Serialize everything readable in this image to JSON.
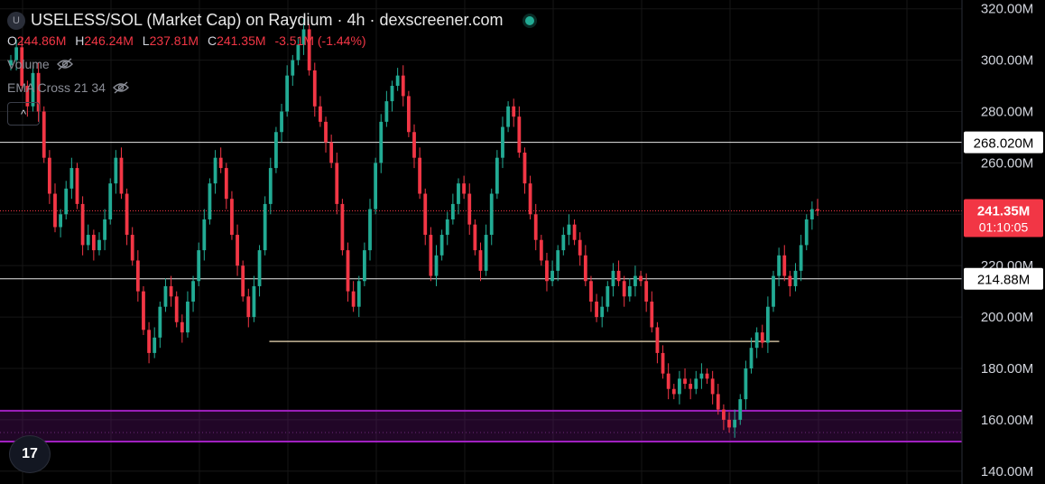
{
  "header": {
    "symbol_initial": "U",
    "title": "USELESS/SOL (Market Cap) on Raydium · 4h · dexscreener.com",
    "ohlc": [
      {
        "key": "O",
        "value": "244.86M"
      },
      {
        "key": "H",
        "value": "246.24M"
      },
      {
        "key": "L",
        "value": "237.81M"
      },
      {
        "key": "C",
        "value": "241.35M"
      }
    ],
    "change": "-3.51M (-1.44%)"
  },
  "indicators": [
    {
      "label": "Volume"
    },
    {
      "label": "EMA Cross 21 34"
    }
  ],
  "collapse_glyph": "^",
  "logo_text": "17",
  "colors": {
    "background": "#000000",
    "up": "#22ab94",
    "down": "#f23645",
    "zone": "#a020c0",
    "white_line": "#e8e8e8",
    "tan_line": "#c8b89a"
  },
  "chart_data": {
    "type": "candlestick",
    "y_unit": "M",
    "ylim": [
      135,
      322
    ],
    "y_ticks": [
      140,
      160,
      180,
      200,
      220,
      240,
      260,
      280,
      300,
      320
    ],
    "y_tick_labels": [
      "140.00M",
      "160.00M",
      "180.00M",
      "200.00M",
      "220.00M",
      "240.00M",
      "260.00M",
      "280.00M",
      "300.00M",
      "320.00M"
    ],
    "horizontal_lines": [
      {
        "value": 268.02,
        "label": "268.020M",
        "style": "solid-white"
      },
      {
        "value": 214.88,
        "label": "214.88M",
        "style": "solid-white"
      },
      {
        "value": 190.5,
        "style": "tan",
        "from": 0.28,
        "to": 0.81
      }
    ],
    "zone": {
      "from": 151.5,
      "to": 163.5
    },
    "last_price": {
      "value": 241.35,
      "label": "241.35M",
      "countdown": "01:10:05"
    },
    "closes": [
      300,
      305,
      290,
      282,
      295,
      280,
      262,
      248,
      235,
      240,
      250,
      258,
      244,
      228,
      232,
      226,
      230,
      238,
      252,
      262,
      248,
      232,
      222,
      210,
      195,
      186,
      192,
      204,
      212,
      208,
      198,
      194,
      206,
      214,
      226,
      238,
      252,
      262,
      258,
      246,
      232,
      220,
      208,
      200,
      212,
      226,
      244,
      258,
      272,
      280,
      294,
      300,
      306,
      312,
      296,
      282,
      276,
      268,
      260,
      244,
      226,
      210,
      204,
      214,
      226,
      242,
      260,
      276,
      284,
      290,
      294,
      286,
      272,
      262,
      248,
      232,
      216,
      224,
      232,
      238,
      244,
      252,
      248,
      236,
      226,
      218,
      232,
      248,
      262,
      274,
      282,
      278,
      264,
      252,
      240,
      230,
      222,
      214,
      218,
      226,
      232,
      236,
      230,
      224,
      214,
      206,
      200,
      204,
      212,
      218,
      214,
      208,
      212,
      216,
      214,
      206,
      196,
      186,
      178,
      172,
      170,
      176,
      174,
      172,
      176,
      178,
      176,
      170,
      164,
      160,
      157,
      160,
      168,
      180,
      188,
      194,
      190,
      204,
      216,
      224,
      216,
      212,
      218,
      228,
      238,
      242,
      241.35
    ]
  }
}
